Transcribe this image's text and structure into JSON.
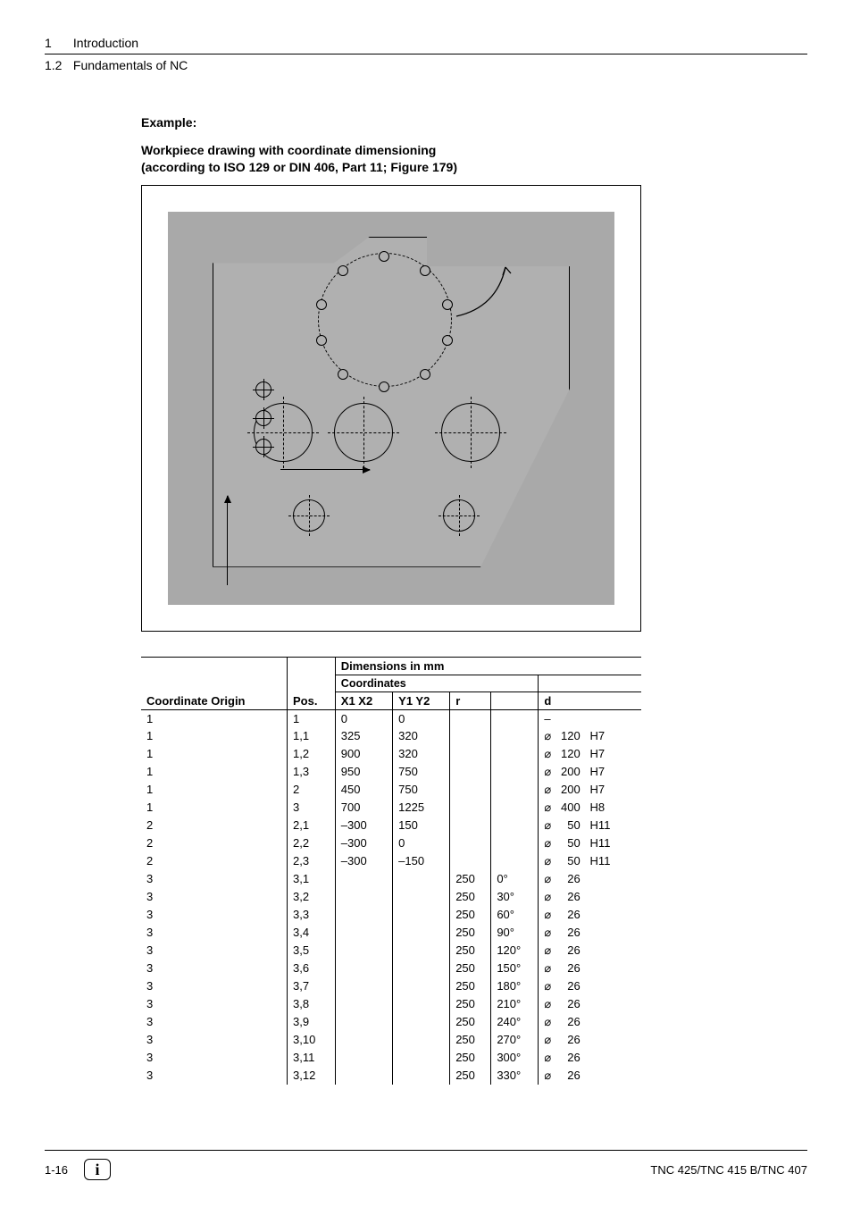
{
  "header": {
    "chapter_num": "1",
    "chapter_title": "Introduction",
    "section_num": "1.2",
    "section_title": "Fundamentals of NC"
  },
  "content": {
    "example_label": "Example:",
    "caption_line1": "Workpiece drawing with coordinate dimensioning",
    "caption_line2": "(according to ISO 129 or DIN 406, Part 11; Figure 179)"
  },
  "table": {
    "head_dimensions": "Dimensions in mm",
    "head_coordinates": "Coordinates",
    "col_origin": "Coordinate Origin",
    "col_pos": "Pos.",
    "col_x": "X1 X2",
    "col_y": "Y1 Y2",
    "col_r": "r",
    "col_angle": "",
    "col_d": "d",
    "rows": [
      {
        "o": "1",
        "p": "1",
        "x": "0",
        "y": "0",
        "r": "",
        "a": "",
        "d": "–",
        "tol": ""
      },
      {
        "o": "1",
        "p": "1,1",
        "x": "325",
        "y": "320",
        "r": "",
        "a": "",
        "d": "⌀   120",
        "tol": "H7"
      },
      {
        "o": "1",
        "p": "1,2",
        "x": "900",
        "y": "320",
        "r": "",
        "a": "",
        "d": "⌀   120",
        "tol": "H7"
      },
      {
        "o": "1",
        "p": "1,3",
        "x": "950",
        "y": "750",
        "r": "",
        "a": "",
        "d": "⌀   200",
        "tol": "H7"
      },
      {
        "o": "1",
        "p": "2",
        "x": "450",
        "y": "750",
        "r": "",
        "a": "",
        "d": "⌀   200",
        "tol": "H7"
      },
      {
        "o": "1",
        "p": "3",
        "x": "700",
        "y": "1225",
        "r": "",
        "a": "",
        "d": "⌀   400",
        "tol": "H8"
      },
      {
        "o": "2",
        "p": "2,1",
        "x": "–300",
        "y": "150",
        "r": "",
        "a": "",
        "d": "⌀     50",
        "tol": "H11"
      },
      {
        "o": "2",
        "p": "2,2",
        "x": "–300",
        "y": "0",
        "r": "",
        "a": "",
        "d": "⌀     50",
        "tol": "H11"
      },
      {
        "o": "2",
        "p": "2,3",
        "x": "–300",
        "y": "–150",
        "r": "",
        "a": "",
        "d": "⌀     50",
        "tol": "H11"
      },
      {
        "o": "3",
        "p": "3,1",
        "x": "",
        "y": "",
        "r": "250",
        "a": "0°",
        "d": "⌀     26",
        "tol": ""
      },
      {
        "o": "3",
        "p": "3,2",
        "x": "",
        "y": "",
        "r": "250",
        "a": "30°",
        "d": "⌀     26",
        "tol": ""
      },
      {
        "o": "3",
        "p": "3,3",
        "x": "",
        "y": "",
        "r": "250",
        "a": "60°",
        "d": "⌀     26",
        "tol": ""
      },
      {
        "o": "3",
        "p": "3,4",
        "x": "",
        "y": "",
        "r": "250",
        "a": "90°",
        "d": "⌀     26",
        "tol": ""
      },
      {
        "o": "3",
        "p": "3,5",
        "x": "",
        "y": "",
        "r": "250",
        "a": "120°",
        "d": "⌀     26",
        "tol": ""
      },
      {
        "o": "3",
        "p": "3,6",
        "x": "",
        "y": "",
        "r": "250",
        "a": "150°",
        "d": "⌀     26",
        "tol": ""
      },
      {
        "o": "3",
        "p": "3,7",
        "x": "",
        "y": "",
        "r": "250",
        "a": "180°",
        "d": "⌀     26",
        "tol": ""
      },
      {
        "o": "3",
        "p": "3,8",
        "x": "",
        "y": "",
        "r": "250",
        "a": "210°",
        "d": "⌀     26",
        "tol": ""
      },
      {
        "o": "3",
        "p": "3,9",
        "x": "",
        "y": "",
        "r": "250",
        "a": "240°",
        "d": "⌀     26",
        "tol": ""
      },
      {
        "o": "3",
        "p": "3,10",
        "x": "",
        "y": "",
        "r": "250",
        "a": "270°",
        "d": "⌀     26",
        "tol": ""
      },
      {
        "o": "3",
        "p": "3,11",
        "x": "",
        "y": "",
        "r": "250",
        "a": "300°",
        "d": "⌀     26",
        "tol": ""
      },
      {
        "o": "3",
        "p": "3,12",
        "x": "",
        "y": "",
        "r": "250",
        "a": "330°",
        "d": "⌀     26",
        "tol": ""
      }
    ]
  },
  "footer": {
    "page": "1-16",
    "product": "TNC 425/TNC 415 B/TNC 407"
  }
}
